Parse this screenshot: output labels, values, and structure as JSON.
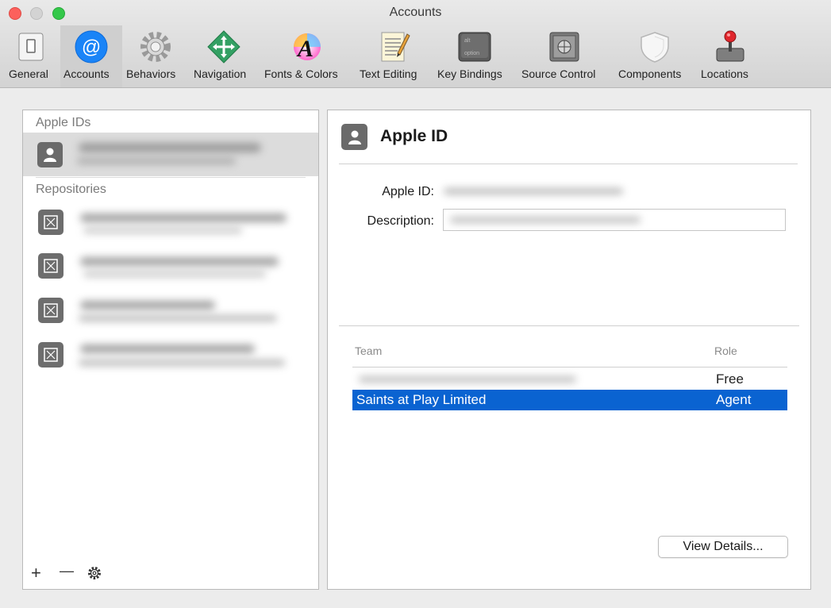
{
  "window": {
    "title": "Accounts"
  },
  "toolbar": {
    "items": [
      {
        "label": "General",
        "icon": "general-icon"
      },
      {
        "label": "Accounts",
        "icon": "at-sign-icon",
        "active": true
      },
      {
        "label": "Behaviors",
        "icon": "gear-icon"
      },
      {
        "label": "Navigation",
        "icon": "navigation-arrows-icon"
      },
      {
        "label": "Fonts & Colors",
        "icon": "font-colors-icon"
      },
      {
        "label": "Text Editing",
        "icon": "text-editing-icon"
      },
      {
        "label": "Key Bindings",
        "icon": "keyboard-key-icon"
      },
      {
        "label": "Source Control",
        "icon": "safe-icon"
      },
      {
        "label": "Components",
        "icon": "shield-icon"
      },
      {
        "label": "Locations",
        "icon": "joystick-icon"
      }
    ]
  },
  "sidebar": {
    "apple_ids_header": "Apple IDs",
    "repositories_header": "Repositories",
    "footer": {
      "add": "+",
      "remove": "—",
      "settings_icon": "gear-icon"
    }
  },
  "detail": {
    "title": "Apple ID",
    "apple_id_label": "Apple ID:",
    "description_label": "Description:",
    "team_header": "Team",
    "role_header": "Role",
    "teams": [
      {
        "team": "",
        "role": "Free"
      },
      {
        "team": "Saints at Play Limited",
        "role": "Agent",
        "selected": true
      }
    ],
    "view_details_label": "View Details..."
  },
  "colors": {
    "selection": "#0a63d1",
    "accounts_icon": "#1a84f7",
    "close": "#fc605c",
    "maximize": "#34c84a"
  }
}
